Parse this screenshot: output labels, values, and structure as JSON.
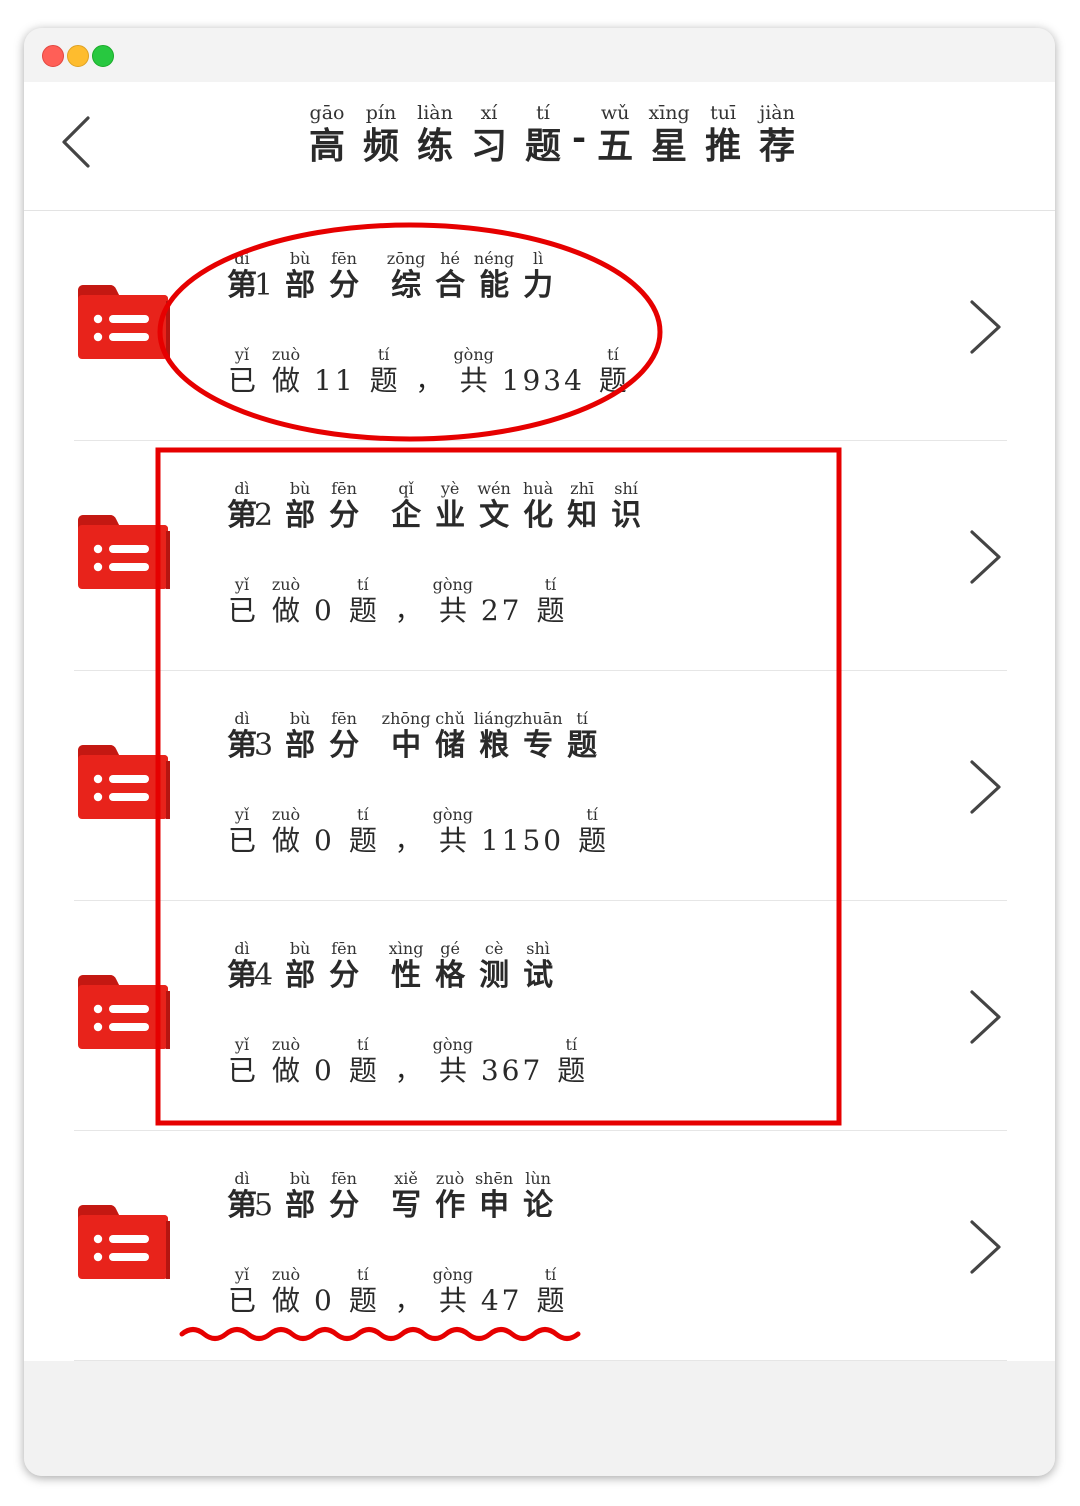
{
  "header": {
    "title_part1": [
      {
        "p": "gāo",
        "c": "高"
      },
      {
        "p": "pín",
        "c": "频"
      },
      {
        "p": "liàn",
        "c": "练"
      },
      {
        "p": "xí",
        "c": "习"
      },
      {
        "p": "tí",
        "c": "题"
      }
    ],
    "dash": "-",
    "title_part2": [
      {
        "p": "wǔ",
        "c": "五"
      },
      {
        "p": "xīng",
        "c": "星"
      },
      {
        "p": "tuī",
        "c": "推"
      },
      {
        "p": "jiàn",
        "c": "荐"
      }
    ]
  },
  "items": [
    {
      "dipy": "dì",
      "di": "第",
      "num": "1",
      "bupy": "bù",
      "bu": "部",
      "fenpy": "fēn",
      "fen": "分",
      "name": [
        {
          "p": "zōng",
          "c": "综"
        },
        {
          "p": "hé",
          "c": "合"
        },
        {
          "p": "néng",
          "c": "能"
        },
        {
          "p": "lì",
          "c": "力"
        }
      ],
      "done": "11",
      "total": "1934"
    },
    {
      "dipy": "dì",
      "di": "第",
      "num": "2",
      "bupy": "bù",
      "bu": "部",
      "fenpy": "fēn",
      "fen": "分",
      "name": [
        {
          "p": "qǐ",
          "c": "企"
        },
        {
          "p": "yè",
          "c": "业"
        },
        {
          "p": "wén",
          "c": "文"
        },
        {
          "p": "huà",
          "c": "化"
        },
        {
          "p": "zhī",
          "c": "知"
        },
        {
          "p": "shí",
          "c": "识"
        }
      ],
      "done": "0",
      "total": "27"
    },
    {
      "dipy": "dì",
      "di": "第",
      "num": "3",
      "bupy": "bù",
      "bu": "部",
      "fenpy": "fēn",
      "fen": "分",
      "name": [
        {
          "p": "zhōng",
          "c": "中"
        },
        {
          "p": "chǔ",
          "c": "储"
        },
        {
          "p": "liáng",
          "c": "粮"
        },
        {
          "p": "zhuān",
          "c": "专"
        },
        {
          "p": "tí",
          "c": "题"
        }
      ],
      "done": "0",
      "total": "1150"
    },
    {
      "dipy": "dì",
      "di": "第",
      "num": "4",
      "bupy": "bù",
      "bu": "部",
      "fenpy": "fēn",
      "fen": "分",
      "name": [
        {
          "p": "xìng",
          "c": "性"
        },
        {
          "p": "gé",
          "c": "格"
        },
        {
          "p": "cè",
          "c": "测"
        },
        {
          "p": "shì",
          "c": "试"
        }
      ],
      "done": "0",
      "total": "367"
    },
    {
      "dipy": "dì",
      "di": "第",
      "num": "5",
      "bupy": "bù",
      "bu": "部",
      "fenpy": "fēn",
      "fen": "分",
      "name": [
        {
          "p": "xiě",
          "c": "写"
        },
        {
          "p": "zuò",
          "c": "作"
        },
        {
          "p": "shēn",
          "c": "申"
        },
        {
          "p": "lùn",
          "c": "论"
        }
      ],
      "done": "0",
      "total": "47"
    }
  ],
  "progress_text": {
    "yi_p": "yǐ",
    "yi": "已",
    "zuo_p": "zuò",
    "zuo": "做",
    "ti_p": "tí",
    "ti": "题",
    "comma": "，",
    "gong_p": "gòng",
    "gong": "共"
  },
  "colors": {
    "accent_red": "#e8231b",
    "annotation_red": "#e60000"
  },
  "icons": {
    "back": "chevron-left-icon",
    "folder": "folder-list-icon",
    "row_arrow": "chevron-right-icon"
  }
}
